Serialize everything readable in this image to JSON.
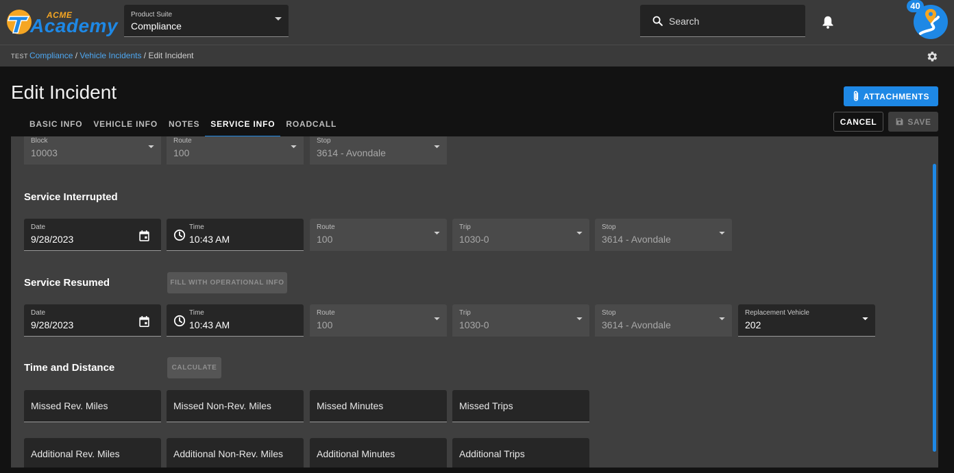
{
  "brand": {
    "small": "ACME",
    "large": "Academy"
  },
  "product_suite": {
    "label": "Product Suite",
    "value": "Compliance"
  },
  "search": {
    "placeholder": "Search"
  },
  "notifications_badge": "40",
  "breadcrumb": {
    "env": "TEST",
    "items": [
      "Compliance",
      "Vehicle Incidents"
    ],
    "separator": " / ",
    "current": "Edit Incident"
  },
  "page_title": "Edit Incident",
  "tabs": [
    "BASIC INFO",
    "VEHICLE INFO",
    "NOTES",
    "SERVICE INFO",
    "ROADCALL"
  ],
  "active_tab": "SERVICE INFO",
  "actions": {
    "attachments": "ATTACHMENTS",
    "cancel": "CANCEL",
    "save": "SAVE"
  },
  "top_row": {
    "block": {
      "label": "Block",
      "value": "10003"
    },
    "route": {
      "label": "Route",
      "value": "100"
    },
    "stop": {
      "label": "Stop",
      "value": "3614 - Avondale"
    }
  },
  "service_interrupted": {
    "title": "Service Interrupted",
    "date": {
      "label": "Date",
      "value": "9/28/2023"
    },
    "time": {
      "label": "Time",
      "value": "10:43 AM"
    },
    "route": {
      "label": "Route",
      "value": "100"
    },
    "trip": {
      "label": "Trip",
      "value": "1030-0"
    },
    "stop": {
      "label": "Stop",
      "value": "3614 - Avondale"
    }
  },
  "service_resumed": {
    "title": "Service Resumed",
    "fill_button": "FILL WITH OPERATIONAL INFO",
    "date": {
      "label": "Date",
      "value": "9/28/2023"
    },
    "time": {
      "label": "Time",
      "value": "10:43 AM"
    },
    "route": {
      "label": "Route",
      "value": "100"
    },
    "trip": {
      "label": "Trip",
      "value": "1030-0"
    },
    "stop": {
      "label": "Stop",
      "value": "3614 - Avondale"
    },
    "replacement_vehicle": {
      "label": "Replacement Vehicle",
      "value": "202"
    }
  },
  "time_distance": {
    "title": "Time and Distance",
    "calculate_button": "CALCULATE",
    "missed": [
      "Missed Rev. Miles",
      "Missed Non-Rev. Miles",
      "Missed Minutes",
      "Missed Trips"
    ],
    "additional": [
      "Additional Rev. Miles",
      "Additional Non-Rev. Miles",
      "Additional Minutes",
      "Additional Trips"
    ]
  },
  "colors": {
    "accent": "#1e88e5",
    "brand_orange": "#f5a623",
    "background": "#121212",
    "panel": "#3f3f3f"
  }
}
